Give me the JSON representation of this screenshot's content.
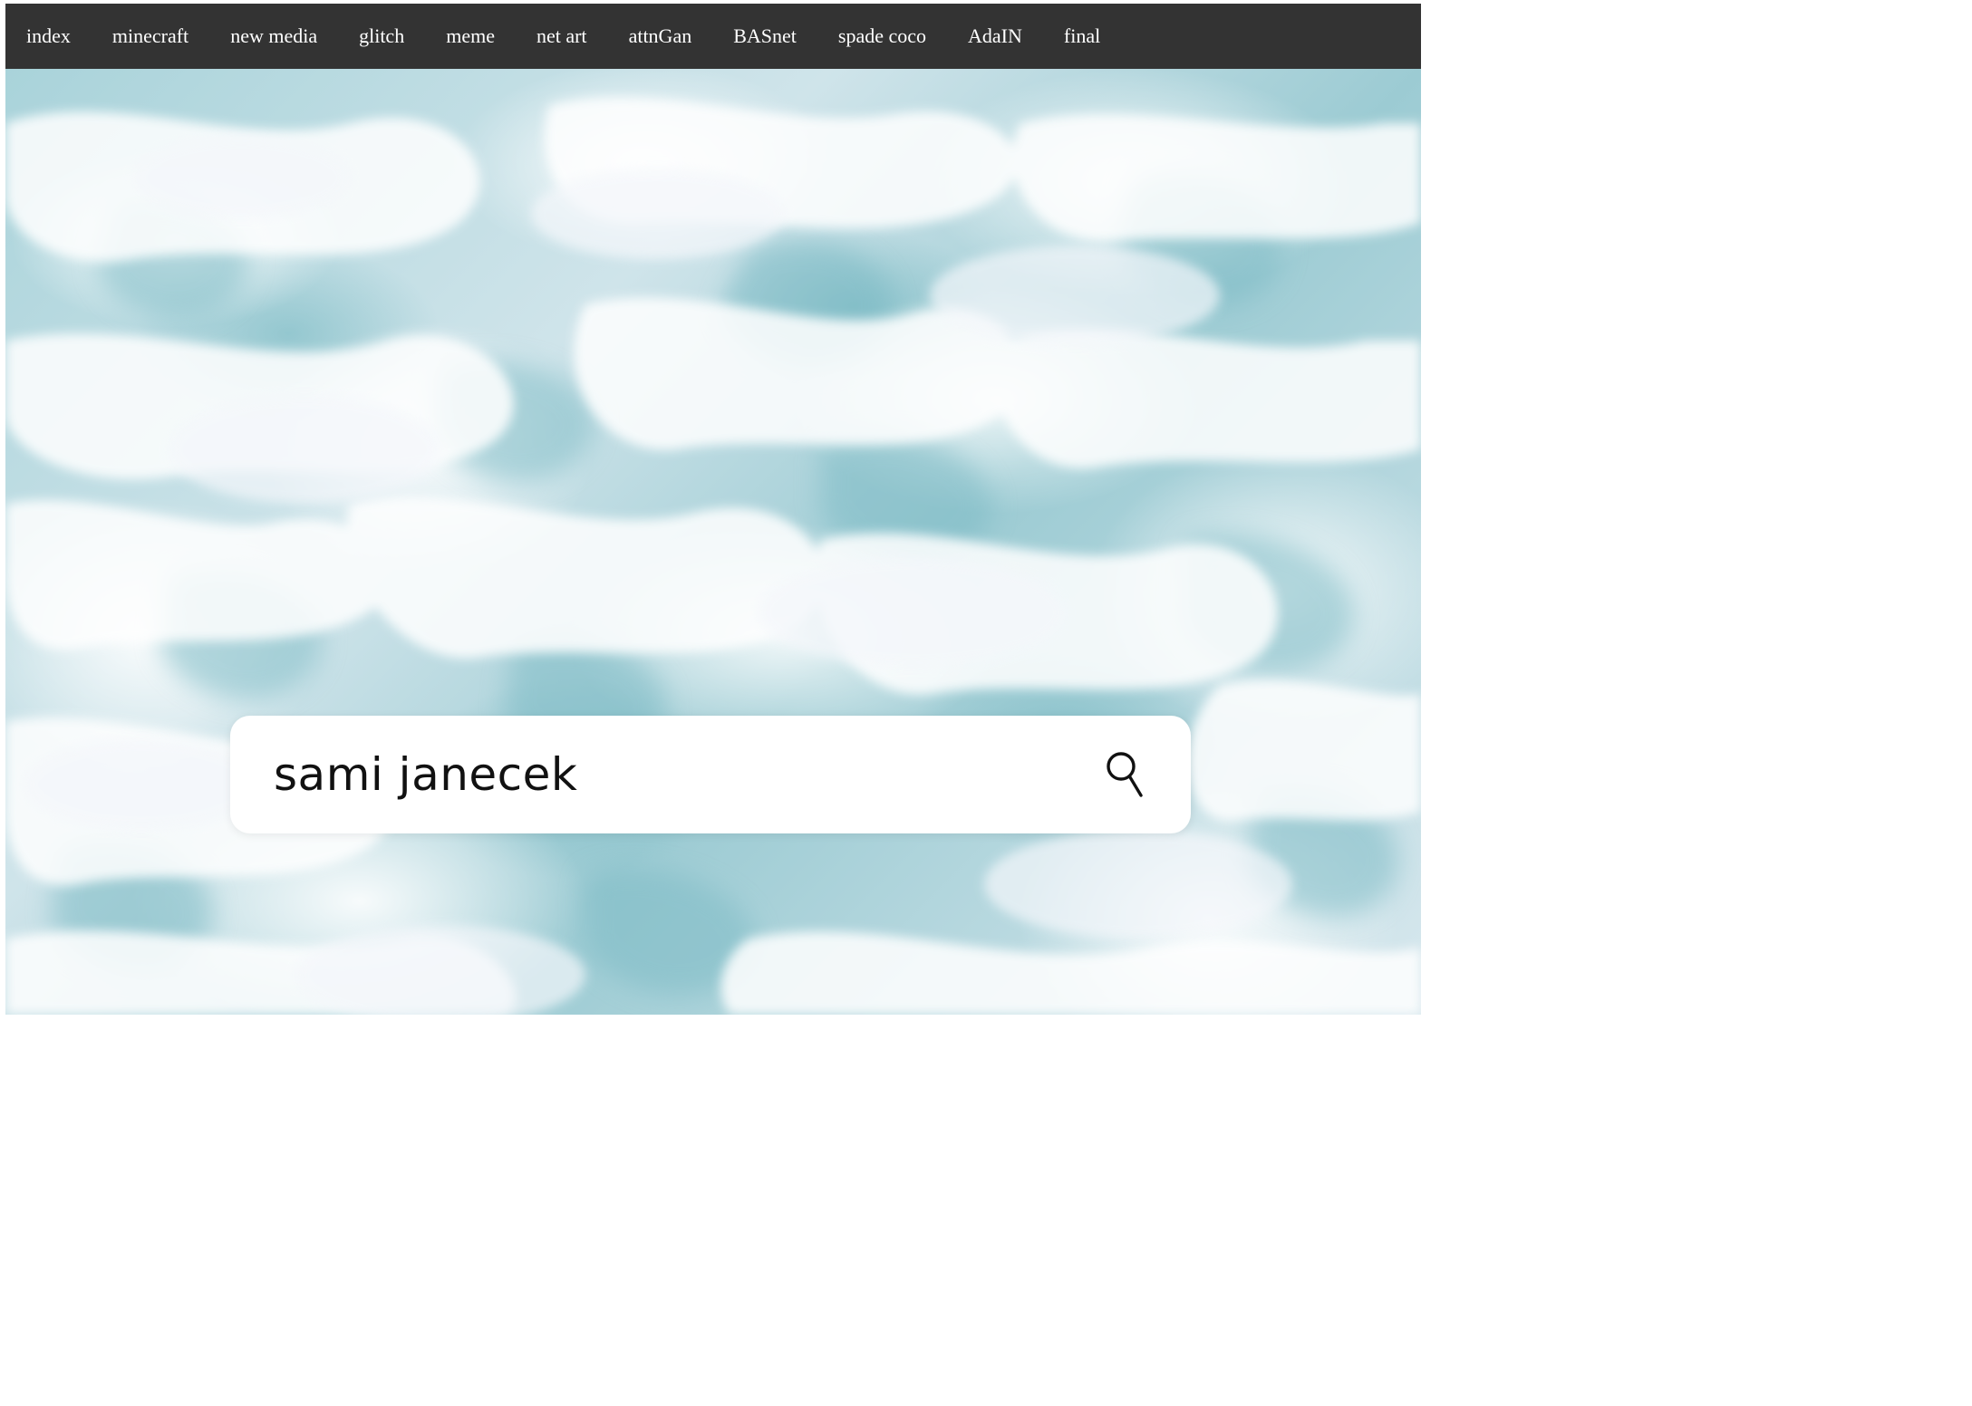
{
  "nav": {
    "items": [
      {
        "label": "index"
      },
      {
        "label": "minecraft"
      },
      {
        "label": "new media"
      },
      {
        "label": "glitch"
      },
      {
        "label": "meme"
      },
      {
        "label": "net art"
      },
      {
        "label": "attnGan"
      },
      {
        "label": "BASnet"
      },
      {
        "label": "spade coco"
      },
      {
        "label": "AdaIN"
      },
      {
        "label": "final"
      }
    ]
  },
  "hero": {
    "search_text": "sami janecek",
    "search_icon": "search-icon"
  },
  "colors": {
    "navbar": "#333333",
    "nav_text": "#ffffff",
    "water_teal": "#8fc4cd",
    "foam": "#ffffff"
  }
}
